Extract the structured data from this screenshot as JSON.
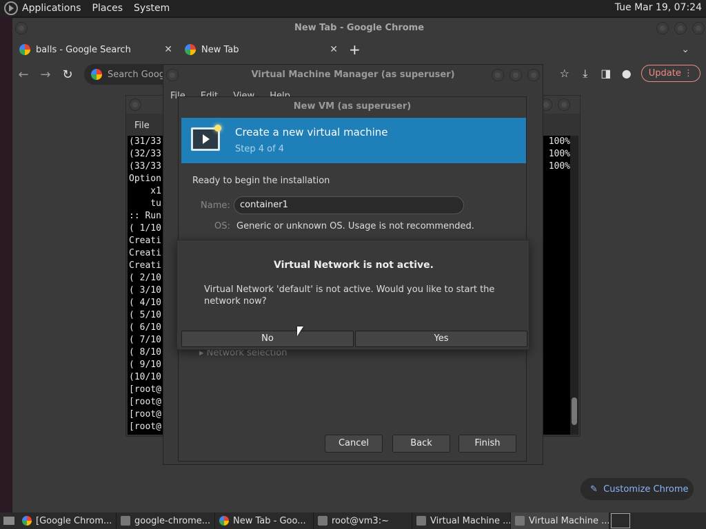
{
  "top_panel": {
    "menus": [
      "Applications",
      "Places",
      "System"
    ],
    "clock": "Tue Mar 19, 07:24"
  },
  "chrome": {
    "title": "New Tab - Google Chrome",
    "tabs": [
      {
        "label": "balls - Google Search"
      },
      {
        "label": "New Tab"
      }
    ],
    "omnibox_placeholder": "Search Goog",
    "update_label": "Update",
    "customize_label": "Customize Chrome"
  },
  "terminal": {
    "menu_file": "File",
    "lines": [
      "(31/33",
      "(32/33",
      "(33/33",
      "Option",
      "    x1",
      "    tu",
      ":: Run",
      "( 1/10",
      "Creati",
      "Creati",
      "Creati",
      "( 2/10",
      "( 3/10",
      "( 4/10",
      "( 5/10",
      "( 6/10",
      "( 7/10",
      "( 8/10",
      "( 9/10",
      "(10/10",
      "[root@",
      "[root@",
      "[root@",
      "[root@"
    ],
    "percents": [
      "100%",
      "100%",
      "100%"
    ]
  },
  "vmm": {
    "title": "Virtual Machine Manager (as superuser)",
    "menus": [
      "File",
      "Edit",
      "View",
      "Help"
    ]
  },
  "newvm": {
    "title": "New VM (as superuser)",
    "banner_title": "Create a new virtual machine",
    "banner_step": "Step 4 of 4",
    "ready_text": "Ready to begin the installation",
    "name_label": "Name:",
    "name_value": "container1",
    "os_label": "OS:",
    "os_value": "Generic or unknown OS. Usage is not recommended.",
    "network_selection": "Network selection",
    "cancel": "Cancel",
    "back": "Back",
    "finish": "Finish"
  },
  "alert": {
    "title": "Virtual Network is not active.",
    "message": "Virtual Network 'default' is not active. Would you like to start the network now?",
    "no": "No",
    "yes": "Yes"
  },
  "taskbar": {
    "items": [
      {
        "label": "[Google Chrom...",
        "icon": "chrome-icon"
      },
      {
        "label": "google-chrome...",
        "icon": "app-icon"
      },
      {
        "label": "New Tab - Goo...",
        "icon": "chrome-icon"
      },
      {
        "label": "root@vm3:~",
        "icon": "terminal-icon"
      },
      {
        "label": "Virtual Machine ...",
        "icon": "vm-icon"
      },
      {
        "label": "Virtual Machine ...",
        "icon": "vm-icon"
      }
    ]
  }
}
